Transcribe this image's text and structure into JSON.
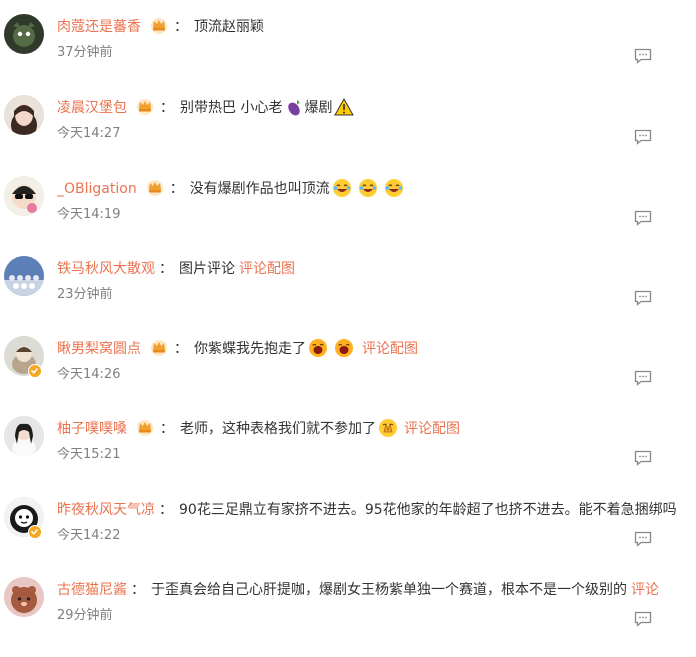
{
  "comments": [
    {
      "user": "肉蔻还是蕃香",
      "colon": "：",
      "text": "顶流赵丽颖",
      "emojis": [],
      "link": "",
      "time": "37分钟前"
    },
    {
      "user": "凌晨汉堡包",
      "colon": "：",
      "text": "别带热巴 小心老",
      "emojis": [
        "eggplant",
        "warning"
      ],
      "text_between": "爆剧",
      "link": "",
      "time": "今天14:27"
    },
    {
      "user": "_OBligation",
      "colon": "：",
      "text": "没有爆剧作品也叫顶流",
      "emojis": [
        "laugh",
        "laugh",
        "laugh"
      ],
      "link": "",
      "time": "今天14:19"
    },
    {
      "user": "铁马秋风大散观",
      "colon": "：",
      "text": "图片评论",
      "emojis": [],
      "link": "评论配图",
      "time": "23分钟前"
    },
    {
      "user": "瞅男梨窝圆点",
      "colon": "：",
      "text": "你紫蝶我先抱走了",
      "emojis": [
        "shout",
        "shout"
      ],
      "link": "评论配图",
      "time": "今天14:26"
    },
    {
      "user": "柚子噗噗嗓",
      "colon": "：",
      "text": "老师，这种表格我们就不参加了",
      "emojis": [
        "pray"
      ],
      "link": "评论配图",
      "time": "今天15:21"
    },
    {
      "user": "昨夜秋风天气凉",
      "colon": "：",
      "text": "90花三足鼎立有家挤不进去。95花他家的年龄超了也挤不进去。能不着急捆绑吗",
      "emojis": [],
      "link": "",
      "time": "今天14:22"
    },
    {
      "user": "古德猫尼酱",
      "colon": "：",
      "text": "于歪真会给自己心肝提咖，爆剧女王杨紫单独一个赛道，根本不是一个级别的",
      "emojis": [],
      "link": "评论",
      "time": "29分钟前"
    }
  ],
  "colors": {
    "username": "#eb7350",
    "text": "#333333",
    "time": "#808080",
    "verified": "#f5a623"
  },
  "icons": {
    "crown": "crown-icon",
    "reply": "comment-reply-icon",
    "verified": "verified-badge-icon"
  }
}
